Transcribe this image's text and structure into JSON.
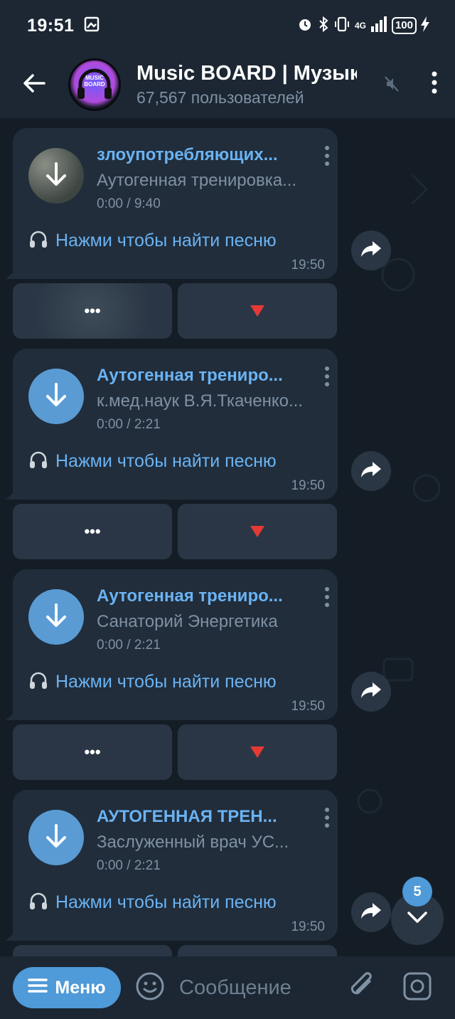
{
  "status_bar": {
    "time": "19:51",
    "network": "4G",
    "battery": "100"
  },
  "header": {
    "avatar_text_line1": "MUSIC",
    "avatar_text_line2": "BOARD",
    "title": "Music BOARD | Музыка",
    "subtitle": "67,567 пользователей"
  },
  "messages": [
    {
      "title": "злоупотребляющих...",
      "artist": "Аутогенная тренировка...",
      "duration": "0:00 / 9:40",
      "find_text": "Нажми чтобы найти песню",
      "time": "19:50",
      "kb_left": "•••",
      "kb_right": "🔻"
    },
    {
      "title": "Аутогенная трениро...",
      "artist": "к.мед.наук В.Я.Ткаченко...",
      "duration": "0:00 / 2:21",
      "find_text": "Нажми чтобы найти песню",
      "time": "19:50",
      "kb_left": "•••",
      "kb_right": "🔻"
    },
    {
      "title": "Аутогенная трениро...",
      "artist": "Санаторий Энергетика",
      "duration": "0:00 / 2:21",
      "find_text": "Нажми чтобы найти песню",
      "time": "19:50",
      "kb_left": "•••",
      "kb_right": "🔻"
    },
    {
      "title": "АУТОГЕННАЯ ТРЕН...",
      "artist": "Заслуженный врач УС...",
      "duration": "0:00 / 2:21",
      "find_text": "Нажми чтобы найти песню",
      "time": "19:50"
    }
  ],
  "unread_count": "5",
  "input_bar": {
    "menu_label": "Меню",
    "placeholder": "Сообщение"
  },
  "colors": {
    "accent": "#6ab3f3",
    "button_blue": "#4f9ad8",
    "bubble": "#212d3b",
    "header": "#1c2733",
    "kb_right_marker": "#e53935"
  },
  "icons": [
    "back-arrow-icon",
    "mute-icon",
    "more-vert-icon",
    "download-icon",
    "headphones-icon",
    "share-icon",
    "chevron-down-icon",
    "menu-lines-icon",
    "emoji-icon",
    "attach-icon",
    "camera-icon"
  ]
}
